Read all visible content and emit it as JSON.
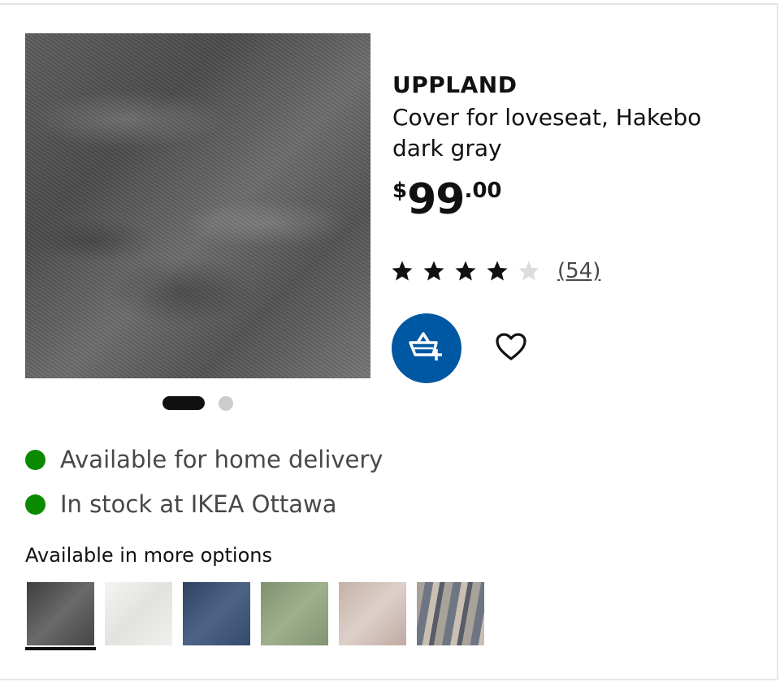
{
  "product": {
    "brand": "UPPLAND",
    "description_line1": "Cover for loveseat, Hakebo",
    "description_line2": "dark gray",
    "price_currency": "$",
    "price_integer": "99",
    "price_decimal": ".00",
    "rating_value": 4,
    "rating_max": 5,
    "review_count": "(54)",
    "image_icon": "fabric-photo"
  },
  "carousel": {
    "total": 2,
    "active_index": 0
  },
  "availability": [
    {
      "label": "Available for home delivery",
      "status_color": "#0a8a00"
    },
    {
      "label": "In stock at IKEA Ottawa",
      "status_color": "#0a8a00"
    }
  ],
  "options": {
    "title": "Available in more options",
    "selected_index": 0,
    "swatches": [
      {
        "name": "dark-gray-swatch",
        "color": "#4e4e4e"
      },
      {
        "name": "white-swatch",
        "color": "#ededea"
      },
      {
        "name": "blue-swatch",
        "color": "#3d5170"
      },
      {
        "name": "green-swatch",
        "color": "#8a9b78"
      },
      {
        "name": "beige-swatch",
        "color": "#cbb9b0"
      },
      {
        "name": "striped-swatch",
        "color": "#8e8780"
      }
    ]
  },
  "colors": {
    "accent_blue": "#0058a3",
    "status_green": "#0a8a00",
    "star_filled": "#111111",
    "star_empty": "#dddddd"
  },
  "icons": {
    "cart": "add-to-cart-icon",
    "wishlist": "heart-icon"
  }
}
